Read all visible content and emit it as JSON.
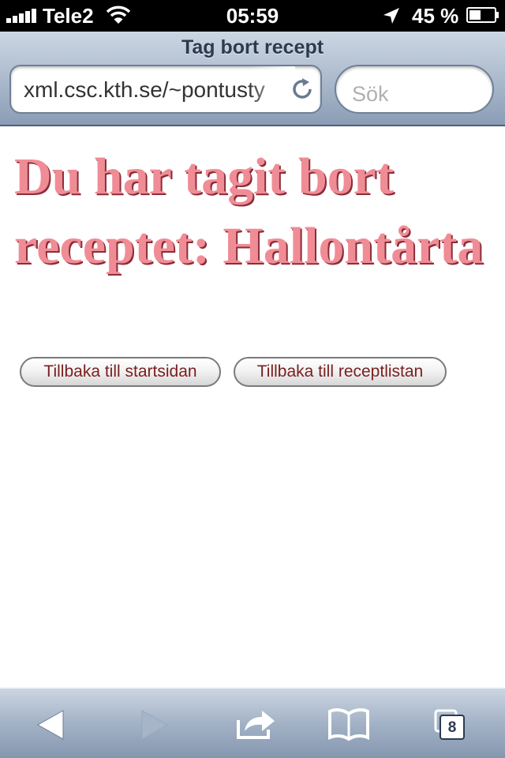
{
  "status_bar": {
    "carrier": "Tele2",
    "time": "05:59",
    "battery": "45 %",
    "icons": [
      "signal-bars-icon",
      "wifi-icon",
      "location-arrow-icon",
      "battery-icon"
    ]
  },
  "browser": {
    "page_title": "Tag bort recept",
    "url": "xml.csc.kth.se/~pontusty",
    "search_placeholder": "Sök",
    "toolbar": {
      "tab_count": "8",
      "icons": [
        "back-icon",
        "forward-icon",
        "share-icon",
        "bookmarks-icon",
        "tabs-icon"
      ]
    }
  },
  "page": {
    "heading": "Du har tagit bort receptet: Hallontårta",
    "buttons": {
      "start": "Tillbaka till startsidan",
      "list": "Tillbaka till receptlistan"
    }
  },
  "colors": {
    "heading": "#f08c95",
    "heading_shadow": "#8a2d38",
    "button_text": "#7a1e1e"
  }
}
